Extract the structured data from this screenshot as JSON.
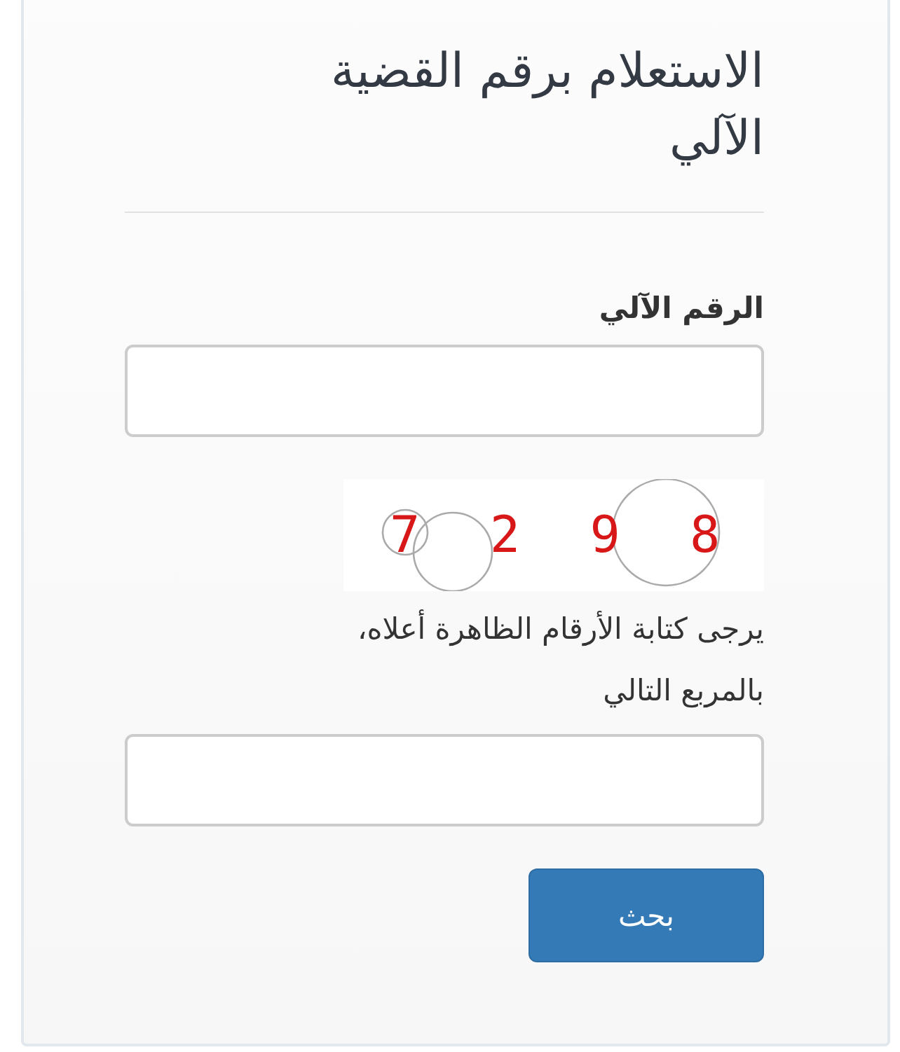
{
  "title": "الاستعلام برقم القضية الآلي",
  "case_field": {
    "label": "الرقم الآلي"
  },
  "captcha": {
    "text": "7 2 9 8"
  },
  "hint_lines": [
    "يرجى كتابة الأرقام الظاهرة أعلاه،",
    "بالمربع التالي"
  ],
  "search_button": {
    "label": "بحث"
  }
}
